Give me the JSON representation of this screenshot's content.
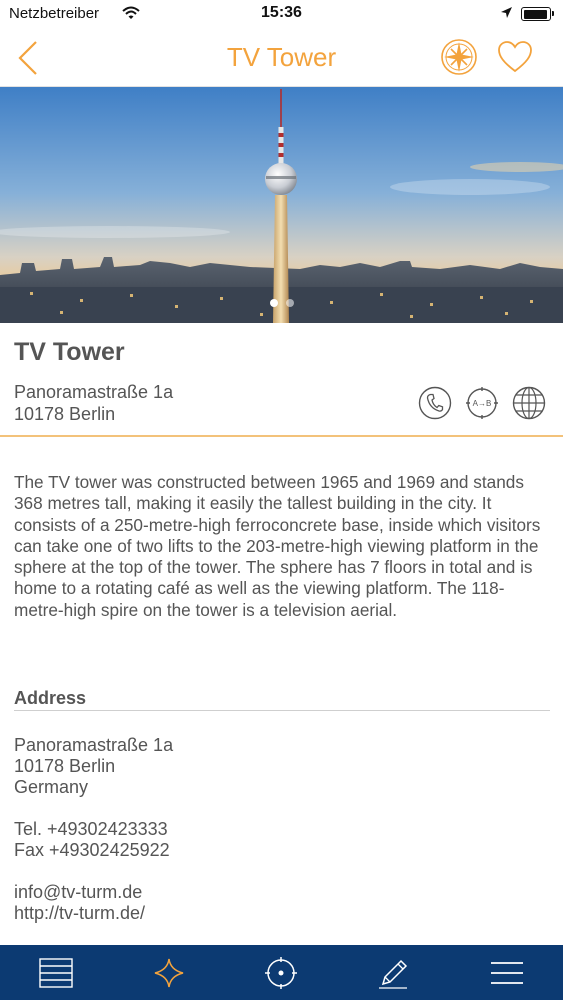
{
  "status_bar": {
    "carrier": "Netzbetreiber",
    "time": "15:36",
    "icons": [
      "wifi-icon",
      "location-arrow-icon",
      "battery-icon"
    ]
  },
  "nav": {
    "title": "TV Tower",
    "back_icon": "chevron-left-icon",
    "compass_icon": "compass-rose-icon",
    "favorite_icon": "heart-icon",
    "accent_color": "#f3a33d"
  },
  "hero": {
    "image": "berlin-tv-tower-photo",
    "page_count": 2,
    "active_page": 1
  },
  "place": {
    "title": "TV Tower",
    "street": "Panoramastraße 1a",
    "city": "10178 Berlin",
    "actions": [
      {
        "icon": "phone-icon"
      },
      {
        "icon": "route-a-to-b-icon",
        "label": "A→B"
      },
      {
        "icon": "globe-icon"
      }
    ]
  },
  "description": "The TV tower was constructed between 1965 and 1969 and stands 368 metres tall, making it easily the tallest building in the city. It consists of a 250-metre-high ferroconcrete base, inside which visitors can take one of two lifts to the 203-metre-high viewing platform in the sphere at the top of the tower. The sphere has 7 floors in total and is home to a rotating café as well as the viewing platform. The 118-metre-high spire on the tower is a television aerial.",
  "address_section": {
    "heading": "Address",
    "street": "Panoramastraße 1a",
    "city": "10178 Berlin",
    "country": "Germany",
    "tel": "Tel. +49302423333",
    "fax": "Fax +49302425922",
    "email": "info@tv-turm.de",
    "website": "http://tv-turm.de/"
  },
  "tab_bar": {
    "background_color": "#0c3a72",
    "tabs": [
      {
        "icon": "list-icon"
      },
      {
        "icon": "star-icon"
      },
      {
        "icon": "target-icon"
      },
      {
        "icon": "pen-icon"
      },
      {
        "icon": "menu-icon"
      }
    ]
  }
}
